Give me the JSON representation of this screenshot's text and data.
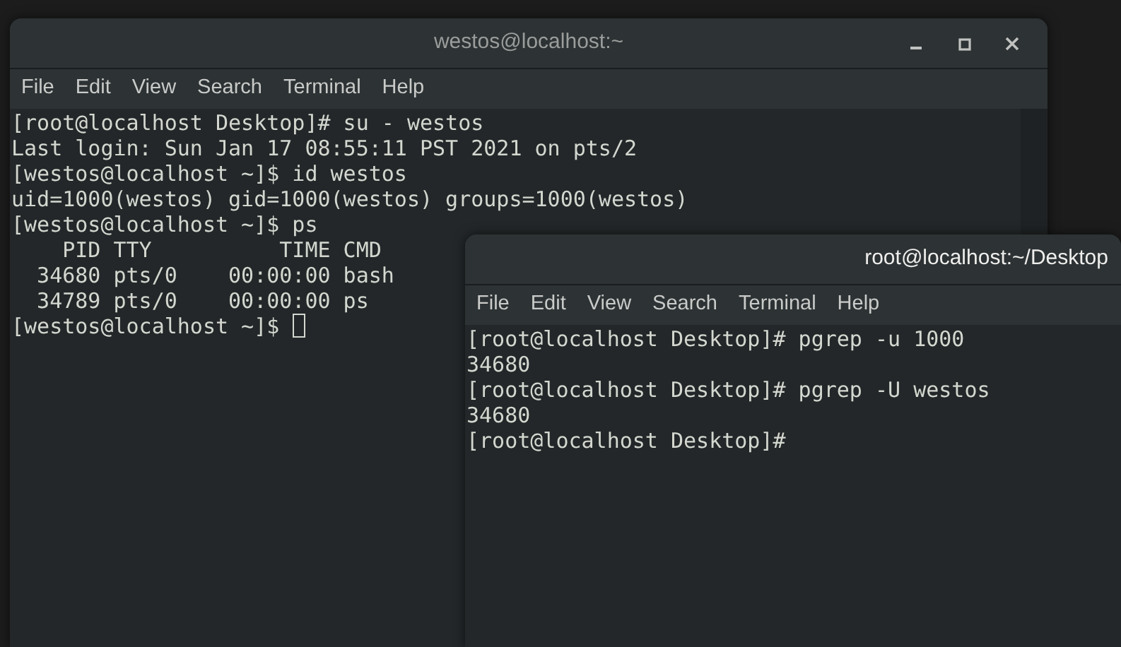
{
  "windows": [
    {
      "title": "westos@localhost:~",
      "focused": false,
      "cursor": true,
      "menu": [
        "File",
        "Edit",
        "View",
        "Search",
        "Terminal",
        "Help"
      ],
      "lines": [
        "[root@localhost Desktop]# su - westos",
        "Last login: Sun Jan 17 08:55:11 PST 2021 on pts/2",
        "[westos@localhost ~]$ id westos",
        "uid=1000(westos) gid=1000(westos) groups=1000(westos)",
        "[westos@localhost ~]$ ps",
        "    PID TTY          TIME CMD",
        "  34680 pts/0    00:00:00 bash",
        "  34789 pts/0    00:00:00 ps",
        "[westos@localhost ~]$ "
      ]
    },
    {
      "title": "root@localhost:~/Desktop",
      "focused": true,
      "cursor": false,
      "menu": [
        "File",
        "Edit",
        "View",
        "Search",
        "Terminal",
        "Help"
      ],
      "lines": [
        "[root@localhost Desktop]# pgrep -u 1000",
        "34680",
        "[root@localhost Desktop]# pgrep -U westos",
        "34680",
        "[root@localhost Desktop]#"
      ]
    }
  ]
}
